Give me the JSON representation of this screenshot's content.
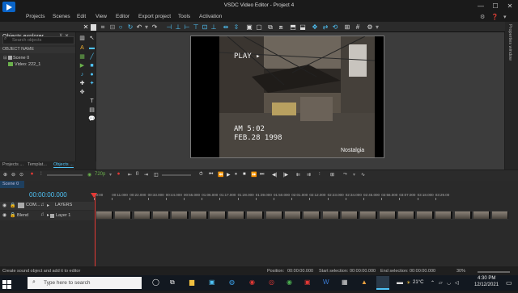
{
  "window": {
    "title": "VSDC Video Editor - Project 4",
    "minimize": "—",
    "maximize": "☐",
    "close": "✕"
  },
  "menu": [
    "Projects",
    "Scenes",
    "Edit",
    "View",
    "Editor",
    "Export project",
    "Tools",
    "Activation"
  ],
  "menu_right": [
    "⚙",
    "❓",
    "▾"
  ],
  "objects_explorer": {
    "title": "Objects explorer",
    "search_placeholder": "Search objects",
    "column_header": "OBJECT NAME",
    "items": [
      "Scene 0",
      "Video: 222_1"
    ]
  },
  "bottom_tabs": [
    "Projects ...",
    "Templat...",
    "Objects ..."
  ],
  "right_panel_tab": "Properties window",
  "preview_overlay": {
    "top_left": "PLAY ▸",
    "time": "AM 5:02",
    "date": "FEB.28 1998",
    "bottom_right": "Nostalgia"
  },
  "timeline": {
    "quality": "720p",
    "scene_tab": "Scene 0",
    "time_display": "00:00:00.000",
    "ruler_ticks": [
      "00:00",
      "00:11.000",
      "00:22.000",
      "00:33.000",
      "00:44.000",
      "00:55.000",
      "01:06.000",
      "01:17.000",
      "01:28.000",
      "01:39.000",
      "01:50.000",
      "02:01.000",
      "02:12.000",
      "02:23.000",
      "02:34.000",
      "02:45.000",
      "02:56.000",
      "03:07.000",
      "03:18.000",
      "03:29.00"
    ],
    "header_com": "COM...",
    "header_layers": "LAYERS",
    "row_blend": "Blend",
    "row_layer": "Layer 1"
  },
  "status": {
    "hint": "Create sound object and add it to editor",
    "position_label": "Position:",
    "position": "00:00:00.000",
    "start_label": "Start selection:",
    "start": "00:00:00.000",
    "end_label": "End selection:",
    "end": "00:00:00.000",
    "zoom": "30%"
  },
  "taskbar": {
    "search_placeholder": "Type here to search",
    "weather": "21°C",
    "time": "4:30 PM",
    "date": "12/12/2021"
  },
  "colors": {
    "accent": "#4fc3f7",
    "playhead": "#e53935",
    "clip": "#5a5a5a"
  }
}
